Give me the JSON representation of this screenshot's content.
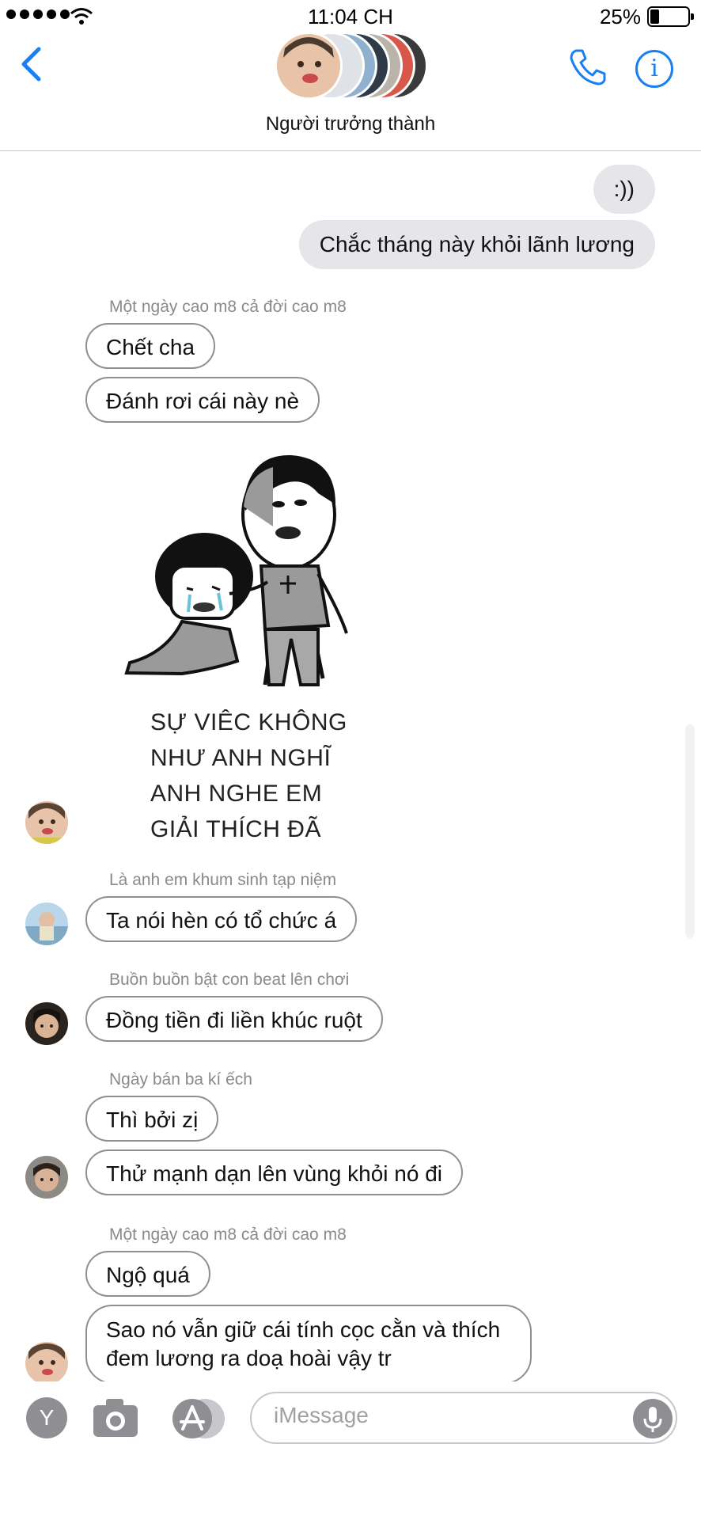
{
  "status_bar": {
    "time": "11:04 CH",
    "battery_percent": "25%",
    "battery_level": 0.25
  },
  "header": {
    "group_name": "Người trưởng thành"
  },
  "messages": {
    "out1": ":))",
    "out2": "Chắc tháng này khỏi lãnh lương",
    "sender1": "Một ngày cao m8 cả đời cao m8",
    "in1": "Chết cha",
    "in2": "Đánh rơi cái này nè",
    "sticker_lines": [
      "SỰ VIÊC KHÔNG",
      "NHƯ ANH NGHĨ",
      "ANH NGHE EM",
      "GIẢI THÍCH ĐÃ"
    ],
    "sender2": "Là anh em khum sinh tạp niệm",
    "in3": "Ta nói hèn có tổ chức á",
    "sender3": "Buồn buồn bật con beat lên chơi",
    "in4": "Đồng tiền đi liền khúc ruột",
    "sender4": "Ngày bán ba kí ếch",
    "in5": "Thì bởi zị",
    "in6": "Thử mạnh dạn lên vùng khỏi nó đi",
    "sender5": "Một ngày cao m8 cả đời cao m8",
    "in7": "Ngộ quá",
    "in8_line1": "Sao nó vẫn giữ cái tính cọc cằn và thích",
    "in8_line2": "đem lương ra doạ hoài vậy tr"
  },
  "input_bar": {
    "app_icon": "Y",
    "placeholder": "iMessage"
  },
  "colors": {
    "accent": "#1a7ff5",
    "bubble_out": "#e5e5ea",
    "bubble_border": "#8e8e93"
  }
}
